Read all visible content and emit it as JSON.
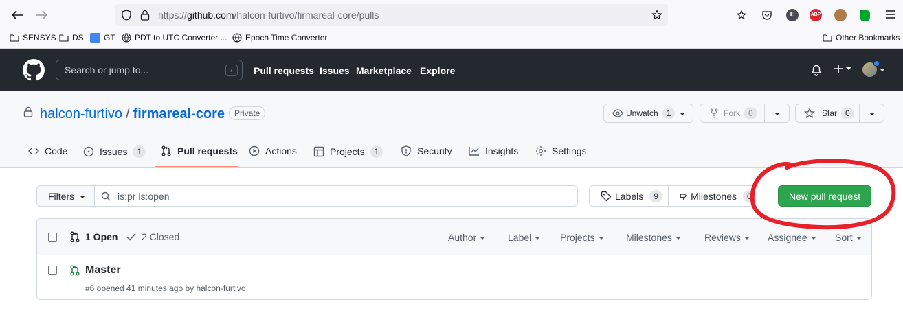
{
  "browser": {
    "url_prefix": "https://",
    "url_host": "github.com",
    "url_path": "/halcon-furtivo/firmareal-core/pulls",
    "bookmarks": [
      "SENSYS",
      "DS",
      "GT",
      "PDT to UTC Converter ...",
      "Epoch Time Converter"
    ],
    "other_bookmarks": "Other Bookmarks",
    "ext_e": "E",
    "ext_abp": "ABP"
  },
  "gh_header": {
    "search_placeholder": "Search or jump to...",
    "slash": "/",
    "nav": [
      "Pull requests",
      "Issues",
      "Marketplace",
      "Explore"
    ]
  },
  "repo": {
    "owner": "halcon-furtivo",
    "separator": "/",
    "name": "firmareal-core",
    "visibility": "Private",
    "unwatch_label": "Unwatch",
    "unwatch_count": "1",
    "fork_label": "Fork",
    "fork_count": "0",
    "star_label": "Star",
    "star_count": "0"
  },
  "tabs": [
    {
      "label": "Code",
      "count": null
    },
    {
      "label": "Issues",
      "count": "1"
    },
    {
      "label": "Pull requests",
      "count": null
    },
    {
      "label": "Actions",
      "count": null
    },
    {
      "label": "Projects",
      "count": "1"
    },
    {
      "label": "Security",
      "count": null
    },
    {
      "label": "Insights",
      "count": null
    },
    {
      "label": "Settings",
      "count": null
    }
  ],
  "filters": {
    "button_label": "Filters",
    "query": "is:pr is:open",
    "labels_label": "Labels",
    "labels_count": "9",
    "milestones_label": "Milestones",
    "milestones_count": "0",
    "new_pr_label": "New pull request"
  },
  "list": {
    "open_label": "1 Open",
    "closed_label": "2 Closed",
    "selectors": [
      "Author",
      "Label",
      "Projects",
      "Milestones",
      "Reviews",
      "Assignee",
      "Sort"
    ],
    "items": [
      {
        "title": "Master",
        "meta": "#6 opened 41 minutes ago by halcon-furtivo"
      }
    ]
  },
  "colors": {
    "gh_header": "#24292f",
    "accent_green": "#2da44e",
    "link_blue": "#0969da",
    "tab_underline": "#fd8c73",
    "annotation_red": "#e8202a"
  }
}
